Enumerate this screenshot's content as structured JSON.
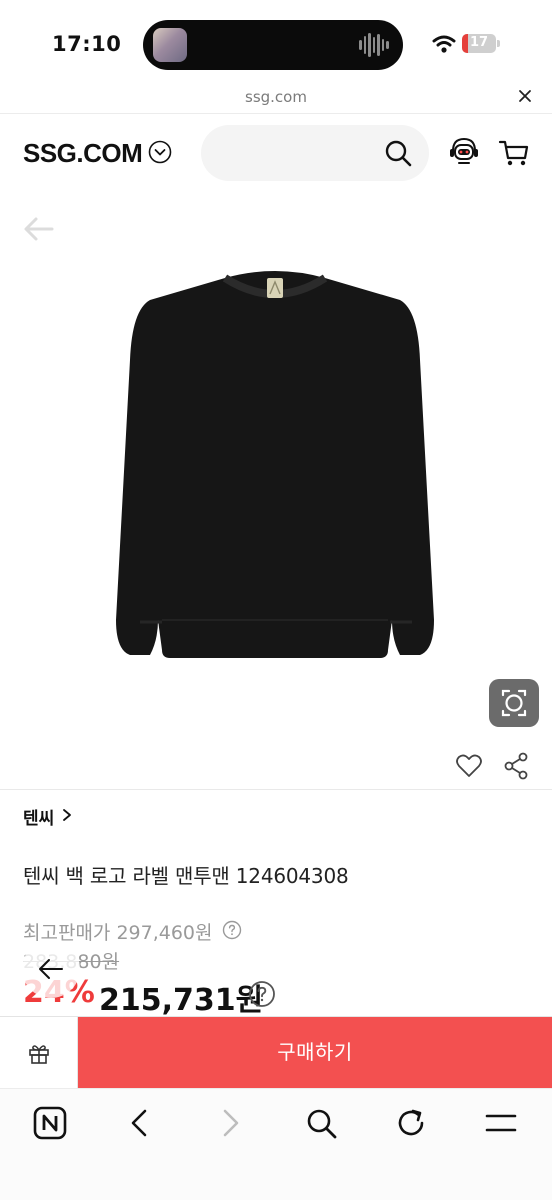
{
  "status_bar": {
    "time": "17:10",
    "battery_level": "17",
    "battery_fraction": 0.17,
    "battery_color": "#e5403b"
  },
  "url_bar": {
    "url": "ssg.com",
    "close_icon": "close-icon"
  },
  "header": {
    "logo": "SSG.COM",
    "search_placeholder": "",
    "icons": [
      "chevron-down-icon",
      "search-icon",
      "chatbot-icon",
      "cart-icon"
    ]
  },
  "product": {
    "brand": "텐씨",
    "name": "텐씨 백 로고 라벨 맨투맨 124604308",
    "max_price_label": "최고판매가 297,460원",
    "original_price": "283,880원",
    "discount": "24%",
    "final_price": "215,731원",
    "image_alt": "black crewneck sweatshirt"
  },
  "purchase": {
    "buy_label": "구매하기",
    "buy_color": "#f35050"
  },
  "browser_toolbar": {
    "icons": [
      "naver-n-icon",
      "back-icon",
      "forward-icon",
      "search-icon",
      "refresh-icon",
      "menu-icon"
    ]
  },
  "colors": {
    "accent": "#ef3b3b",
    "muted": "#9a9a9a"
  }
}
